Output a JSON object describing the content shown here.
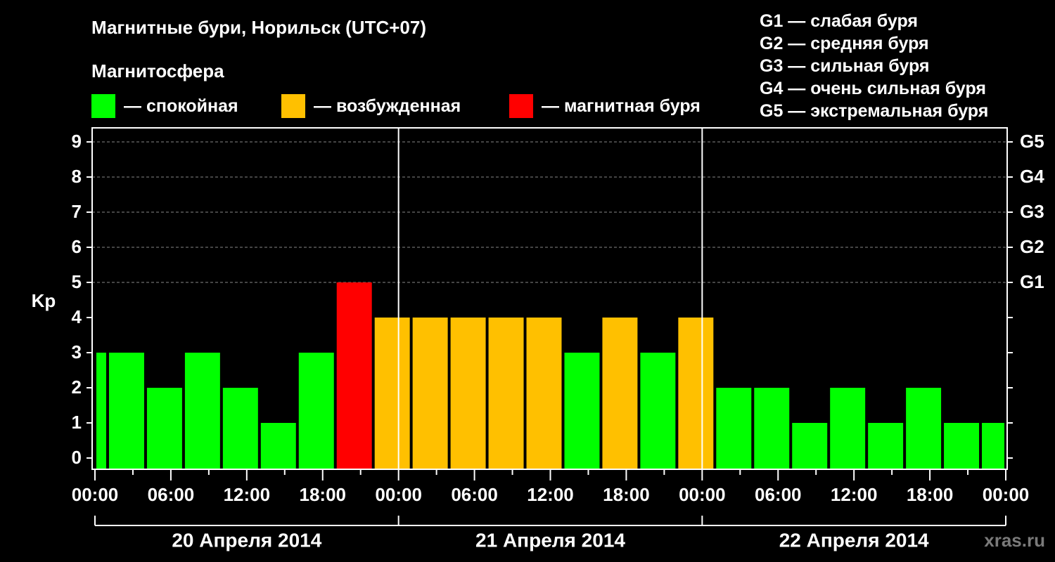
{
  "header": {
    "title": "Магнитные бури, Норильск (UTC+07)",
    "subtitle": "Магнитосфера"
  },
  "legend": [
    {
      "label": "— спокойная",
      "color": "#00ff00"
    },
    {
      "label": "— возбужденная",
      "color": "#ffc000"
    },
    {
      "label": "— магнитная буря",
      "color": "#ff0000"
    }
  ],
  "g_legend": [
    "G1 — слабая буря",
    "G2 — средняя буря",
    "G3 — сильная буря",
    "G4 — очень сильная буря",
    "G5 — экстремальная буря"
  ],
  "watermark": "xras.ru",
  "chart_data": {
    "type": "bar",
    "ylabel": "Kp",
    "ylim": [
      0,
      9
    ],
    "yticks": [
      "0",
      "1",
      "2",
      "3",
      "4",
      "5",
      "6",
      "7",
      "8",
      "9"
    ],
    "right_ticks": [
      {
        "value": 5,
        "label": "G1"
      },
      {
        "value": 6,
        "label": "G2"
      },
      {
        "value": 7,
        "label": "G3"
      },
      {
        "value": 8,
        "label": "G4"
      },
      {
        "value": 9,
        "label": "G5"
      }
    ],
    "xtick_labels": [
      "00:00",
      "06:00",
      "12:00",
      "18:00",
      "00:00",
      "06:00",
      "12:00",
      "18:00",
      "00:00",
      "06:00",
      "12:00",
      "18:00",
      "00:00"
    ],
    "days": [
      "20 Апреля 2014",
      "21 Апреля 2014",
      "22 Апреля 2014"
    ],
    "grid": true,
    "colors": {
      "quiet": "#00ff00",
      "active": "#ffc000",
      "storm": "#ff0000"
    },
    "bars": [
      {
        "start_hour": 0,
        "end_hour": 1,
        "kp": 3,
        "level": "quiet"
      },
      {
        "start_hour": 1,
        "end_hour": 4,
        "kp": 3,
        "level": "quiet"
      },
      {
        "start_hour": 4,
        "end_hour": 7,
        "kp": 2,
        "level": "quiet"
      },
      {
        "start_hour": 7,
        "end_hour": 10,
        "kp": 3,
        "level": "quiet"
      },
      {
        "start_hour": 10,
        "end_hour": 13,
        "kp": 2,
        "level": "quiet"
      },
      {
        "start_hour": 13,
        "end_hour": 16,
        "kp": 1,
        "level": "quiet"
      },
      {
        "start_hour": 16,
        "end_hour": 19,
        "kp": 3,
        "level": "quiet"
      },
      {
        "start_hour": 19,
        "end_hour": 22,
        "kp": 5,
        "level": "storm"
      },
      {
        "start_hour": 22,
        "end_hour": 25,
        "kp": 4,
        "level": "active"
      },
      {
        "start_hour": 25,
        "end_hour": 28,
        "kp": 4,
        "level": "active"
      },
      {
        "start_hour": 28,
        "end_hour": 31,
        "kp": 4,
        "level": "active"
      },
      {
        "start_hour": 31,
        "end_hour": 34,
        "kp": 4,
        "level": "active"
      },
      {
        "start_hour": 34,
        "end_hour": 37,
        "kp": 4,
        "level": "active"
      },
      {
        "start_hour": 37,
        "end_hour": 40,
        "kp": 3,
        "level": "quiet"
      },
      {
        "start_hour": 40,
        "end_hour": 43,
        "kp": 4,
        "level": "active"
      },
      {
        "start_hour": 43,
        "end_hour": 46,
        "kp": 3,
        "level": "quiet"
      },
      {
        "start_hour": 46,
        "end_hour": 49,
        "kp": 4,
        "level": "active"
      },
      {
        "start_hour": 49,
        "end_hour": 52,
        "kp": 2,
        "level": "quiet"
      },
      {
        "start_hour": 52,
        "end_hour": 55,
        "kp": 2,
        "level": "quiet"
      },
      {
        "start_hour": 55,
        "end_hour": 58,
        "kp": 1,
        "level": "quiet"
      },
      {
        "start_hour": 58,
        "end_hour": 61,
        "kp": 2,
        "level": "quiet"
      },
      {
        "start_hour": 61,
        "end_hour": 64,
        "kp": 1,
        "level": "quiet"
      },
      {
        "start_hour": 64,
        "end_hour": 67,
        "kp": 2,
        "level": "quiet"
      },
      {
        "start_hour": 67,
        "end_hour": 70,
        "kp": 1,
        "level": "quiet"
      },
      {
        "start_hour": 70,
        "end_hour": 72,
        "kp": 1,
        "level": "quiet"
      }
    ]
  }
}
